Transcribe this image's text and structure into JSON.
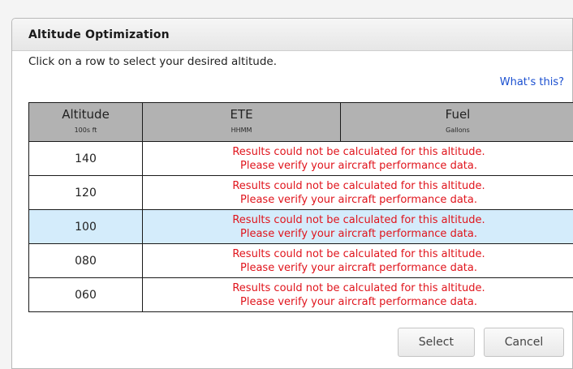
{
  "dialog": {
    "title": "Altitude Optimization",
    "instructions": "Click on a row to select your desired altitude.",
    "help_link": "What's this?"
  },
  "table": {
    "columns": [
      {
        "label": "Altitude",
        "unit": "100s ft"
      },
      {
        "label": "ETE",
        "unit": "HHMM"
      },
      {
        "label": "Fuel",
        "unit": "Gallons"
      }
    ],
    "rows": [
      {
        "altitude": "140",
        "message_line1": "Results could not be calculated for this altitude.",
        "message_line2": "Please verify your aircraft performance data.",
        "selected": false
      },
      {
        "altitude": "120",
        "message_line1": "Results could not be calculated for this altitude.",
        "message_line2": "Please verify your aircraft performance data.",
        "selected": false
      },
      {
        "altitude": "100",
        "message_line1": "Results could not be calculated for this altitude.",
        "message_line2": "Please verify your aircraft performance data.",
        "selected": true
      },
      {
        "altitude": "080",
        "message_line1": "Results could not be calculated for this altitude.",
        "message_line2": "Please verify your aircraft performance data.",
        "selected": false
      },
      {
        "altitude": "060",
        "message_line1": "Results could not be calculated for this altitude.",
        "message_line2": "Please verify your aircraft performance data.",
        "selected": false
      }
    ]
  },
  "buttons": {
    "select_label": "Select",
    "cancel_label": "Cancel"
  },
  "colors": {
    "error_text": "#e0141c",
    "selected_row": "#d4ecfb",
    "header_bg": "#b2b2b2",
    "link": "#1a4fd0"
  }
}
